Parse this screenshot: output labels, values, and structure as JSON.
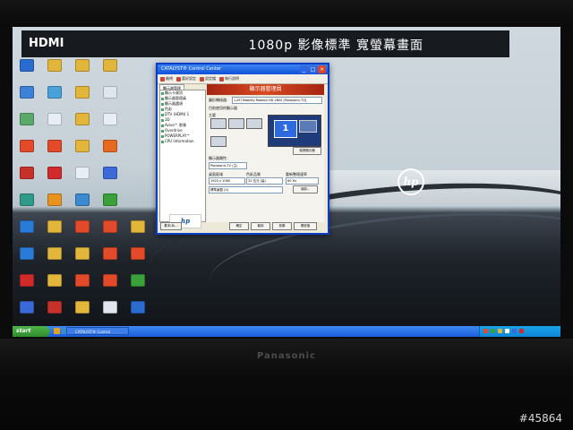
{
  "osd": {
    "input": "HDMI",
    "info": "1080p  影像標準  寬螢幕畫面"
  },
  "tv": {
    "brand": "Panasonic"
  },
  "watermark": "#45864",
  "desktop": {
    "colors": {
      "accent": "#1d5ddc",
      "window_border": "#0a3ec8",
      "banner_red": "#c93a1c"
    },
    "icons": [
      {
        "label": "",
        "color": "#2a6bd0"
      },
      {
        "label": "",
        "color": "#e2b53b"
      },
      {
        "label": "",
        "color": "#e2b53b"
      },
      {
        "label": "",
        "color": "#e2b53b"
      },
      {
        "label": "",
        "color": "#3c82d8"
      },
      {
        "label": "",
        "color": "#4aa0d8"
      },
      {
        "label": "",
        "color": "#e2b53b"
      },
      {
        "label": "",
        "color": "#dfe6ee"
      },
      {
        "label": "",
        "color": "#5aa86a"
      },
      {
        "label": "",
        "color": "#e8eef5"
      },
      {
        "label": "",
        "color": "#e2b53b"
      },
      {
        "label": "",
        "color": "#e8eef5"
      },
      {
        "label": "",
        "color": "#e24a2a"
      },
      {
        "label": "",
        "color": "#e24a2a"
      },
      {
        "label": "",
        "color": "#e2b53b"
      },
      {
        "label": "",
        "color": "#e86a20"
      },
      {
        "label": "",
        "color": "#c8302a"
      },
      {
        "label": "",
        "color": "#d22a2a"
      },
      {
        "label": "",
        "color": "#e8eef5"
      },
      {
        "label": "",
        "color": "#3c6ad8"
      },
      {
        "label": "",
        "color": "#2f9a8a"
      },
      {
        "label": "",
        "color": "#e89220"
      },
      {
        "label": "",
        "color": "#3a8ad0"
      },
      {
        "label": "",
        "color": "#39a03a"
      },
      {
        "label": "",
        "color": "#2a7ad8"
      },
      {
        "label": "",
        "color": "#e2b53b"
      },
      {
        "label": "",
        "color": "#e24a2a"
      },
      {
        "label": "",
        "color": "#e24a2a"
      },
      {
        "label": "",
        "color": "#2a7ad8"
      },
      {
        "label": "",
        "color": "#e2b53b"
      },
      {
        "label": "",
        "color": "#e2b53b"
      },
      {
        "label": "",
        "color": "#e24a2a"
      },
      {
        "label": "",
        "color": "#d22a2a"
      },
      {
        "label": "",
        "color": "#e2b53b"
      },
      {
        "label": "",
        "color": "#e24a2a"
      },
      {
        "label": "",
        "color": "#e24a2a"
      },
      {
        "label": "",
        "color": "#3a6ad8"
      },
      {
        "label": "",
        "color": "#c8302a"
      },
      {
        "label": "",
        "color": "#e2b53b"
      },
      {
        "label": "",
        "color": "#dfe6ee"
      }
    ],
    "right_icons": [
      {
        "label": "",
        "color": "#e2b53b"
      },
      {
        "label": "",
        "color": "#e24a2a"
      },
      {
        "label": "",
        "color": "#39a03a"
      },
      {
        "label": "",
        "color": "#2a6bd0"
      }
    ]
  },
  "window": {
    "title": "CATALYST® Control Center",
    "toolbar": [
      "檢視",
      "喜好設定",
      "設定檔",
      "執行說明"
    ],
    "tab": "顯示器管理",
    "tree": [
      "顯示卡資訊",
      "顯示器管理員",
      "顯示器選項",
      "色彩",
      "DTV (HDMI) 1",
      "3D",
      "Avivo™ 影像",
      "Overdrive",
      "POWERPLAY™",
      "CPU Information"
    ],
    "banner": "顯示器管理員",
    "graphics_label": "圖形轉接器:",
    "graphics_value": "1-ATI Mobility Radeon HD 2600 [Panasonic-TV]",
    "current_label": "目前使用的顯示器",
    "main_label": "主要",
    "display_number": "1",
    "detect_button": "偵測顯示器",
    "properties_label": "顯示器屬性:",
    "monitor_select": "Panasonic-TV (主)",
    "resolution_label": "桌面區域",
    "resolution_value": "1920 x 1080",
    "color_label": "色彩品質",
    "color_value": "32 位元 (高)",
    "refresh_label": "重新整理速率",
    "refresh_value": "60 Hz",
    "rotation_value": "標準景觀 (0)",
    "apply_button": "強制...",
    "foot_buttons": [
      "基本(B)...",
      "確定",
      "套用",
      "放棄",
      "預設值"
    ]
  },
  "taskbar": {
    "start_label": "start",
    "task_label": "CATALYST® Control",
    "clock": ""
  }
}
